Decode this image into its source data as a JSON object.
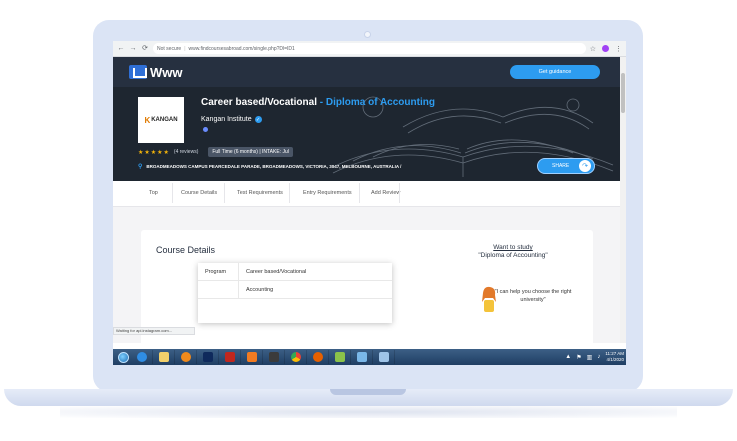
{
  "browser": {
    "back": "←",
    "forward": "→",
    "reload": "⟳",
    "security": "Not secure",
    "url": "www.findcoursesabroad.com/single.php?Dl=ID1",
    "bookmark": "☆",
    "menu": "⋮"
  },
  "site": {
    "logo_text": "Www",
    "cta": "Get guidance"
  },
  "course": {
    "title": "Career based/Vocational",
    "separator": " - ",
    "subtitle": "Diploma of Accounting",
    "institute": "Kangan Institute",
    "logo_text": "KANGAN",
    "stars": "★★★★★",
    "reviews": "(4 reviews)",
    "badge": "Full Time (6 months) | INTAKE: Jul",
    "address": "BROADMEADOWS CAMPUS PEARCEDALE PARADE, BROADMEADOWS, VICTORIA, 3047, MELBOURNE, AUSTRALIA /",
    "share": "SHARE"
  },
  "tabs": [
    "Top",
    "Course Details",
    "Test Requirements",
    "Entry Requirements",
    "Add Review"
  ],
  "details": {
    "heading": "Course Details",
    "rows": [
      {
        "key": "Program",
        "value": "Career based/Vocational"
      },
      {
        "key": "",
        "value": "Accounting"
      }
    ]
  },
  "sidebar": {
    "heading": "Want to study",
    "course": "\"Diploma of Accounting\"",
    "help": "\"I can help you choose the right university\""
  },
  "status": "Waiting for api.instagram.com...",
  "taskbar": {
    "time": "11:27 AM",
    "date": "4/1/2020"
  },
  "colors": {
    "navy": "#263040",
    "accent": "#2d9cf0",
    "stars": "#f5b50a"
  }
}
